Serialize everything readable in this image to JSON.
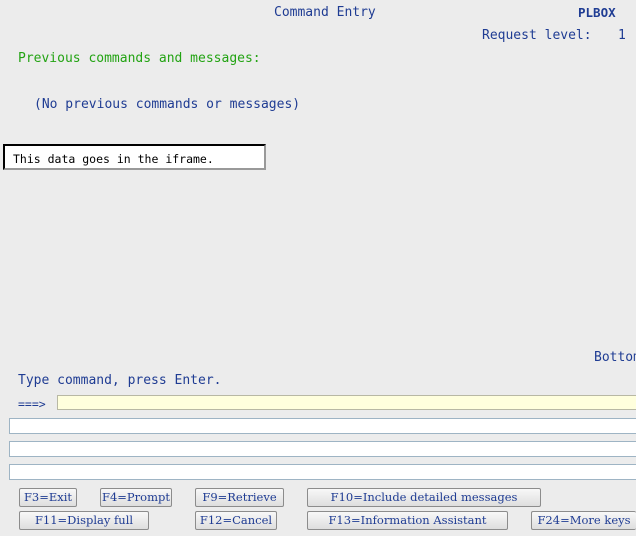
{
  "header": {
    "title": "Command Entry",
    "system": "PLBOX",
    "request_level_label": "Request level:",
    "request_level_value": "1"
  },
  "messages": {
    "heading": "Previous commands and messages:",
    "empty_text": "(No previous commands or messages)"
  },
  "iframe": {
    "text": "This data goes in the iframe."
  },
  "status": {
    "bottom": "Bottom"
  },
  "command": {
    "instruction": "Type command, press Enter.",
    "prompt": "===>",
    "value": ""
  },
  "function_keys": [
    {
      "label": "F3=Exit"
    },
    {
      "label": "F4=Prompt"
    },
    {
      "label": "F9=Retrieve"
    },
    {
      "label": "F10=Include detailed messages"
    },
    {
      "label": "F11=Display full"
    },
    {
      "label": "F12=Cancel"
    },
    {
      "label": "F13=Information Assistant"
    },
    {
      "label": "F24=More keys"
    }
  ]
}
